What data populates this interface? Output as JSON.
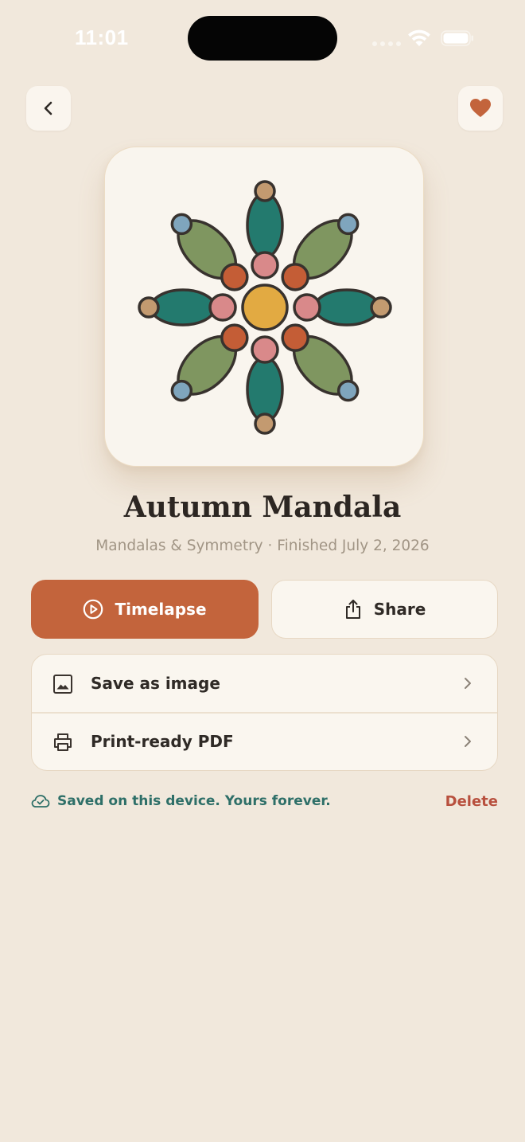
{
  "status_bar": {
    "time": "11:01"
  },
  "header": {
    "back_icon": "chevron-left-icon",
    "favorite_icon": "heart-icon"
  },
  "artwork": {
    "colors": {
      "teal": "#237a6e",
      "olive": "#7f9660",
      "terracotta": "#c45d36",
      "pink": "#d9898a",
      "mustard": "#e2aa42",
      "tan": "#c39a70",
      "blue": "#7fa5bd",
      "outline": "#38322e"
    }
  },
  "title": "Autumn Mandala",
  "subtitle": "Mandalas & Symmetry · Finished July 2, 2026",
  "actions": {
    "timelapse_label": "Timelapse",
    "timelapse_icon": "play-circle-icon",
    "share_label": "Share",
    "share_icon": "share-icon"
  },
  "options": [
    {
      "label": "Save as image",
      "icon": "image-icon"
    },
    {
      "label": "Print-ready PDF",
      "icon": "printer-icon"
    }
  ],
  "footer": {
    "saved_note": "Saved on this device. Yours forever.",
    "saved_icon": "cloud-check-icon",
    "delete_label": "Delete"
  },
  "theme": {
    "background": "#f1e8dc",
    "accent": "#c3643c",
    "success": "#2e6f68",
    "danger": "#b8503e"
  }
}
